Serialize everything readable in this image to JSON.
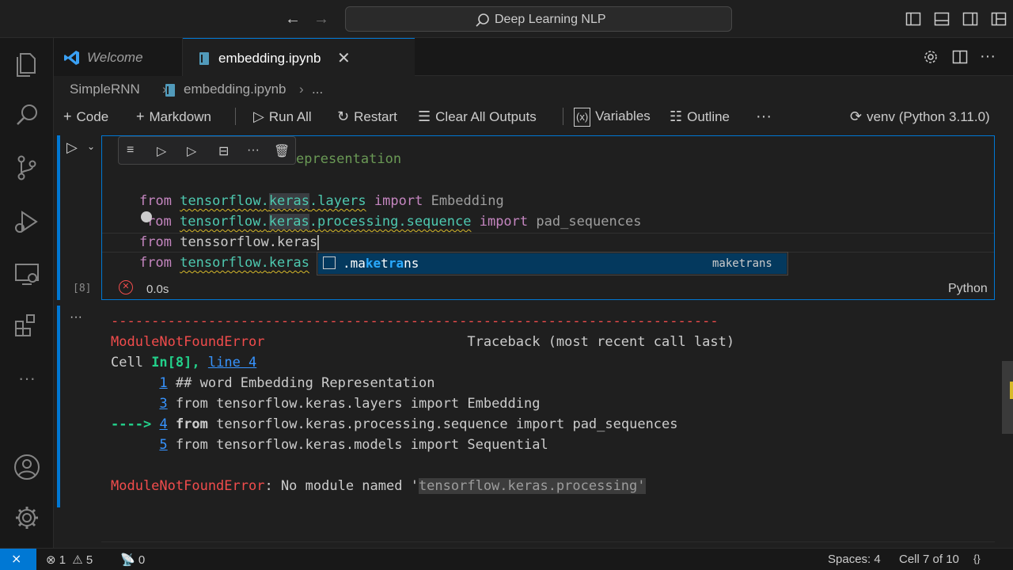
{
  "titlebar": {
    "search_text": "Deep Learning NLP"
  },
  "tabs": [
    {
      "label": "Welcome"
    },
    {
      "label": "embedding.ipynb"
    }
  ],
  "breadcrumb": {
    "folder": "SimpleRNN",
    "file": "embedding.ipynb",
    "more": "..."
  },
  "toolbar": {
    "code": "Code",
    "markdown": "Markdown",
    "run_all": "Run All",
    "restart": "Restart",
    "clear_outputs": "Clear All Outputs",
    "variables": "Variables",
    "outline": "Outline",
    "more": "···",
    "kernel": "venv (Python 3.11.0)"
  },
  "cell": {
    "line1_tail": "epresentation",
    "l2_from": "from",
    "l2_pkg": "tensorflow",
    "l2_dot1": ".",
    "l2_keras": "keras",
    "l2_rest": ".layers",
    "l2_import": "import",
    "l2_name": "Embedding",
    "l3_from": "rom",
    "l3_pkg": "tensorflow",
    "l3_dot1": ".",
    "l3_keras": "keras",
    "l3_rest": ".processing.sequence",
    "l3_import": "import",
    "l3_name": "pad_sequences",
    "l4_from": "from",
    "l4_text": "tenssorflow.keras",
    "l5_from": "from",
    "l5_pkg": "tensorflow",
    "l5_dot1": ".",
    "l5_keras": "keras",
    "execution_count": "[8]",
    "duration": "0.0s",
    "language": "Python"
  },
  "suggestion": {
    "label_pre": ".",
    "label_m1": "ma",
    "label_k": "ke",
    "label_t": "t",
    "label_r": "ra",
    "label_n": "ns",
    "detail": "maketrans"
  },
  "output": {
    "more": "···",
    "dashes": "---------------------------------------------------------------------------",
    "error_name": "ModuleNotFoundError",
    "traceback": "Traceback (most recent call last)",
    "cell_prefix": "Cell ",
    "cell_in": "In[8],",
    "cell_line": "line 4",
    "lines": [
      {
        "num": "1",
        "text": " ## word Embedding Representation"
      },
      {
        "num": "3",
        "text": " from tensorflow.keras.layers import Embedding"
      },
      {
        "num": "4",
        "text": " tensorflow.keras.processing.sequence import pad_sequences"
      },
      {
        "num": "5",
        "text": " from tensorflow.keras.models import Sequential"
      }
    ],
    "arrow": "---->",
    "arrow_from": "from",
    "final_error": "ModuleNotFoundError",
    "final_msg": ": No module named '",
    "final_module": "tensorflow.keras.processing",
    "final_quote": "'"
  },
  "statusbar": {
    "errors": "1",
    "warnings": "5",
    "ports": "0",
    "spaces": "Spaces: 4",
    "cell_pos": "Cell 7 of 10"
  }
}
